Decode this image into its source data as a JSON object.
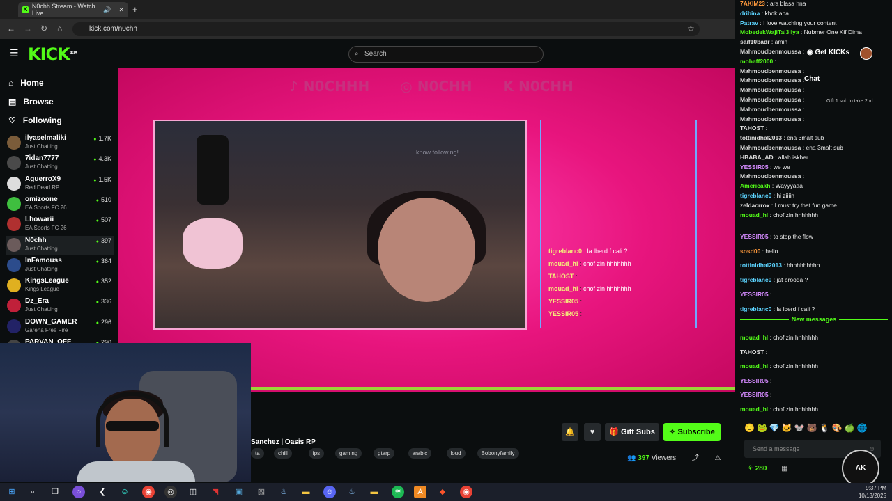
{
  "browser": {
    "tab_title": "N0chh Stream - Watch Live",
    "url": "kick.com/n0chh"
  },
  "header": {
    "logo": "KICK",
    "logo_badge": "BETA",
    "search_placeholder": "Search",
    "get_kicks": "Get KICKs"
  },
  "sidebar": {
    "nav": [
      {
        "label": "Home",
        "icon": "home-icon"
      },
      {
        "label": "Browse",
        "icon": "browse-icon"
      },
      {
        "label": "Following",
        "icon": "heart-icon"
      }
    ],
    "channels": [
      {
        "name": "ilyaselmaliki",
        "category": "Just Chatting",
        "viewers": "1.7K",
        "color": "#7b5c3a"
      },
      {
        "name": "7idan7777",
        "category": "Just Chatting",
        "viewers": "4.3K",
        "color": "#4a4a4a"
      },
      {
        "name": "AguerroX9",
        "category": "Red Dead RP",
        "viewers": "1.5K",
        "color": "#ddd"
      },
      {
        "name": "omizoone",
        "category": "EA Sports FC 26",
        "viewers": "510",
        "color": "#3fbf3f"
      },
      {
        "name": "Lhowarii",
        "category": "EA Sports FC 26",
        "viewers": "507",
        "color": "#b03030"
      },
      {
        "name": "N0chh",
        "category": "Just Chatting",
        "viewers": "397",
        "color": "#6b5b5b"
      },
      {
        "name": "InFamouss",
        "category": "Just Chatting",
        "viewers": "364",
        "color": "#2c4c8c"
      },
      {
        "name": "KingsLeague",
        "category": "Kings League",
        "viewers": "352",
        "color": "#e0b020"
      },
      {
        "name": "Dz_Era",
        "category": "Just Chatting",
        "viewers": "336",
        "color": "#c0203a"
      },
      {
        "name": "DOWN_GAMER",
        "category": "Garena Free Fire",
        "viewers": "296",
        "color": "#222266"
      },
      {
        "name": "PARVAN_OFF",
        "category": "",
        "viewers": "290",
        "color": "#444"
      }
    ]
  },
  "stream": {
    "socials": [
      "N0CHHH",
      "N0CHH",
      "N0CHH"
    ],
    "overlay_chat": [
      {
        "user": "tigreblanc0",
        "text": "la lberd f cali ?"
      },
      {
        "user": "mouad_hl",
        "text": "chof zin hhhhhhh"
      },
      {
        "user": "TAHOST",
        "text": ""
      },
      {
        "user": "mouad_hl",
        "text": "chof zin hhhhhhh"
      },
      {
        "user": "YESSIR05",
        "text": ""
      },
      {
        "user": "YESSIR05",
        "text": ""
      }
    ],
    "cam_text": "know following!"
  },
  "info": {
    "title_fragment": "Sanchez | Oasis RP",
    "tags": [
      "ta",
      "chill",
      "fps",
      "gaming",
      "gtarp",
      "arabic",
      "loud",
      "Bobonyfamily"
    ],
    "gift_subs": "Gift Subs",
    "subscribe": "Subscribe",
    "viewer_count": "397",
    "viewers_label": "Viewers"
  },
  "chat": {
    "messages_top": [
      {
        "user": "7AKIM23",
        "text": "ara blasa hna",
        "color": "#ff9a3c"
      },
      {
        "user": "dribina",
        "text": "khok ana",
        "color": "#5cd4ff"
      },
      {
        "user": "Patrav",
        "text": "I love watching your content",
        "color": "#5cd4ff"
      },
      {
        "user": "MobedekWajiTal3liya",
        "text": "Nubmer One Kif Dima",
        "color": "#53fc18"
      },
      {
        "user": "saif10badr",
        "text": "amin",
        "color": "#ddd"
      },
      {
        "user": "Mahmoudbenmoussa",
        "text": "",
        "color": "#ddd"
      },
      {
        "user": "mohaff2000",
        "text": "",
        "color": "#53fc18"
      },
      {
        "user": "Mahmoudbenmoussa",
        "text": "",
        "color": "#ddd"
      },
      {
        "user": "Mahmoudbenmoussa",
        "text": "",
        "color": "#ddd"
      },
      {
        "user": "Mahmoudbenmoussa",
        "text": "",
        "color": "#ddd"
      },
      {
        "user": "Mahmoudbenmoussa",
        "text": "",
        "color": "#ddd"
      },
      {
        "user": "Mahmoudbenmoussa",
        "text": "",
        "color": "#ddd"
      },
      {
        "user": "Mahmoudbenmoussa",
        "text": "",
        "color": "#ddd"
      },
      {
        "user": "TAHOST",
        "text": "",
        "color": "#ddd"
      },
      {
        "user": "tottinidhal2013",
        "text": "ena 3malt sub",
        "color": "#ddd"
      },
      {
        "user": "Mahmoudbenmoussa",
        "text": "ena 3malt sub",
        "color": "#ddd"
      },
      {
        "user": "HBABA_AD",
        "text": "allah iskher",
        "color": "#ddd"
      },
      {
        "user": "YESSIR05",
        "text": "we we",
        "color": "#d58bff"
      },
      {
        "user": "Mahmoudbenmoussa",
        "text": "",
        "color": "#ddd"
      },
      {
        "user": "Americakh",
        "text": "Wayyyaaa",
        "color": "#53fc18"
      },
      {
        "user": "tigreblanc0",
        "text": "hi ziiiin",
        "color": "#5cd4ff"
      },
      {
        "user": "zeldacrrox",
        "text": "I must try that fun game",
        "color": "#ddd"
      },
      {
        "user": "mouad_hl",
        "text": "chof zin hhhhhhh",
        "color": "#53fc18"
      }
    ],
    "messages_mid": [
      {
        "user": "YESSIR05",
        "text": "to stop the flow",
        "color": "#d58bff"
      },
      {
        "user": "sosd00",
        "text": "hello",
        "color": "#ff9a3c"
      },
      {
        "user": "tottinidhal2013",
        "text": "hhhhhhhhhh",
        "color": "#5cd4ff"
      },
      {
        "user": "tigreblanc0",
        "text": "jat brooda ?",
        "color": "#5cd4ff"
      },
      {
        "user": "YESSIR05",
        "text": "",
        "color": "#d58bff"
      },
      {
        "user": "tigreblanc0",
        "text": "la lberd f cali ?",
        "color": "#5cd4ff"
      }
    ],
    "new_messages_label": "New messages",
    "messages_new": [
      {
        "user": "mouad_hl",
        "text": "chof zin hhhhhhh",
        "color": "#53fc18"
      },
      {
        "user": "TAHOST",
        "text": "",
        "color": "#ddd"
      },
      {
        "user": "mouad_hl",
        "text": "chof zin hhhhhhh",
        "color": "#53fc18"
      },
      {
        "user": "YESSIR05",
        "text": "",
        "color": "#d58bff"
      },
      {
        "user": "YESSIR05",
        "text": "",
        "color": "#d58bff"
      },
      {
        "user": "mouad_hl",
        "text": "chof zin hhhhhhh",
        "color": "#53fc18"
      }
    ],
    "chat_header": "Chat",
    "gift_banner": "Gift 1 sub to take 2nd",
    "input_placeholder": "Send a message",
    "kicks_count": "280",
    "ak_logo": "AK"
  },
  "taskbar": {
    "time": "9:37 PM",
    "date": "10/13/2025"
  },
  "colors": {
    "brand_green": "#53fc18",
    "stream_pink": "#e8157e"
  }
}
